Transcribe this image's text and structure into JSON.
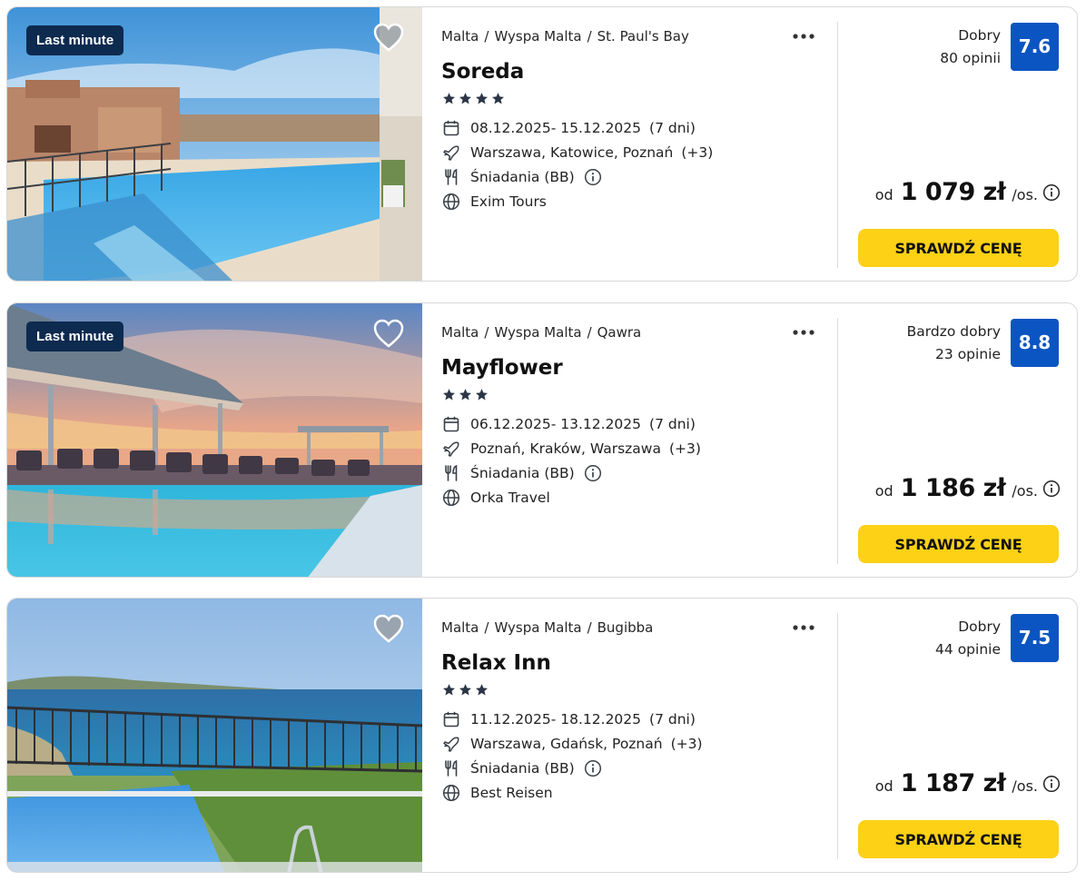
{
  "offers": [
    {
      "badge": "Last minute",
      "breadcrumb": [
        "Malta",
        "Wyspa Malta",
        "St. Paul's Bay"
      ],
      "name": "Soreda",
      "stars": 4,
      "dates": "08.12.2025- 15.12.2025",
      "duration": "(7 dni)",
      "departures": "Warszawa, Katowice, Poznań",
      "departures_more": "(+3)",
      "board": "Śniadania (BB)",
      "operator": "Exim Tours",
      "rating_label": "Dobry",
      "rating_count": "80 opinii",
      "rating_score": "7.6",
      "price_prefix": "od",
      "price": "1 079 zł",
      "price_suffix": "/os.",
      "cta": "SPRAWDŹ CENĘ",
      "favorite_filled": true,
      "image": "hotel-pool-terrace"
    },
    {
      "badge": "Last minute",
      "breadcrumb": [
        "Malta",
        "Wyspa Malta",
        "Qawra"
      ],
      "name": "Mayflower",
      "stars": 3,
      "dates": "06.12.2025- 13.12.2025",
      "duration": "(7 dni)",
      "departures": "Poznań, Kraków, Warszawa",
      "departures_more": "(+3)",
      "board": "Śniadania (BB)",
      "operator": "Orka Travel",
      "rating_label": "Bardzo dobry",
      "rating_count": "23 opinie",
      "rating_score": "8.8",
      "price_prefix": "od",
      "price": "1 186 zł",
      "price_suffix": "/os.",
      "cta": "SPRAWDŹ CENĘ",
      "favorite_filled": false,
      "image": "rooftop-pool-sunset"
    },
    {
      "badge": "",
      "breadcrumb": [
        "Malta",
        "Wyspa Malta",
        "Bugibba"
      ],
      "name": "Relax Inn",
      "stars": 3,
      "dates": "11.12.2025- 18.12.2025",
      "duration": "(7 dni)",
      "departures": "Warszawa, Gdańsk, Poznań",
      "departures_more": "(+3)",
      "board": "Śniadania (BB)",
      "operator": "Best Reisen",
      "rating_label": "Dobry",
      "rating_count": "44 opinie",
      "rating_score": "7.5",
      "price_prefix": "od",
      "price": "1 187 zł",
      "price_suffix": "/os.",
      "cta": "SPRAWDŹ CENĘ",
      "favorite_filled": true,
      "image": "sea-view-balcony-pool"
    }
  ],
  "colors": {
    "badge_bg": "#0d2a4f",
    "score_bg": "#0b55c2",
    "cta_bg": "#fcd116",
    "star": "#2c3545"
  }
}
